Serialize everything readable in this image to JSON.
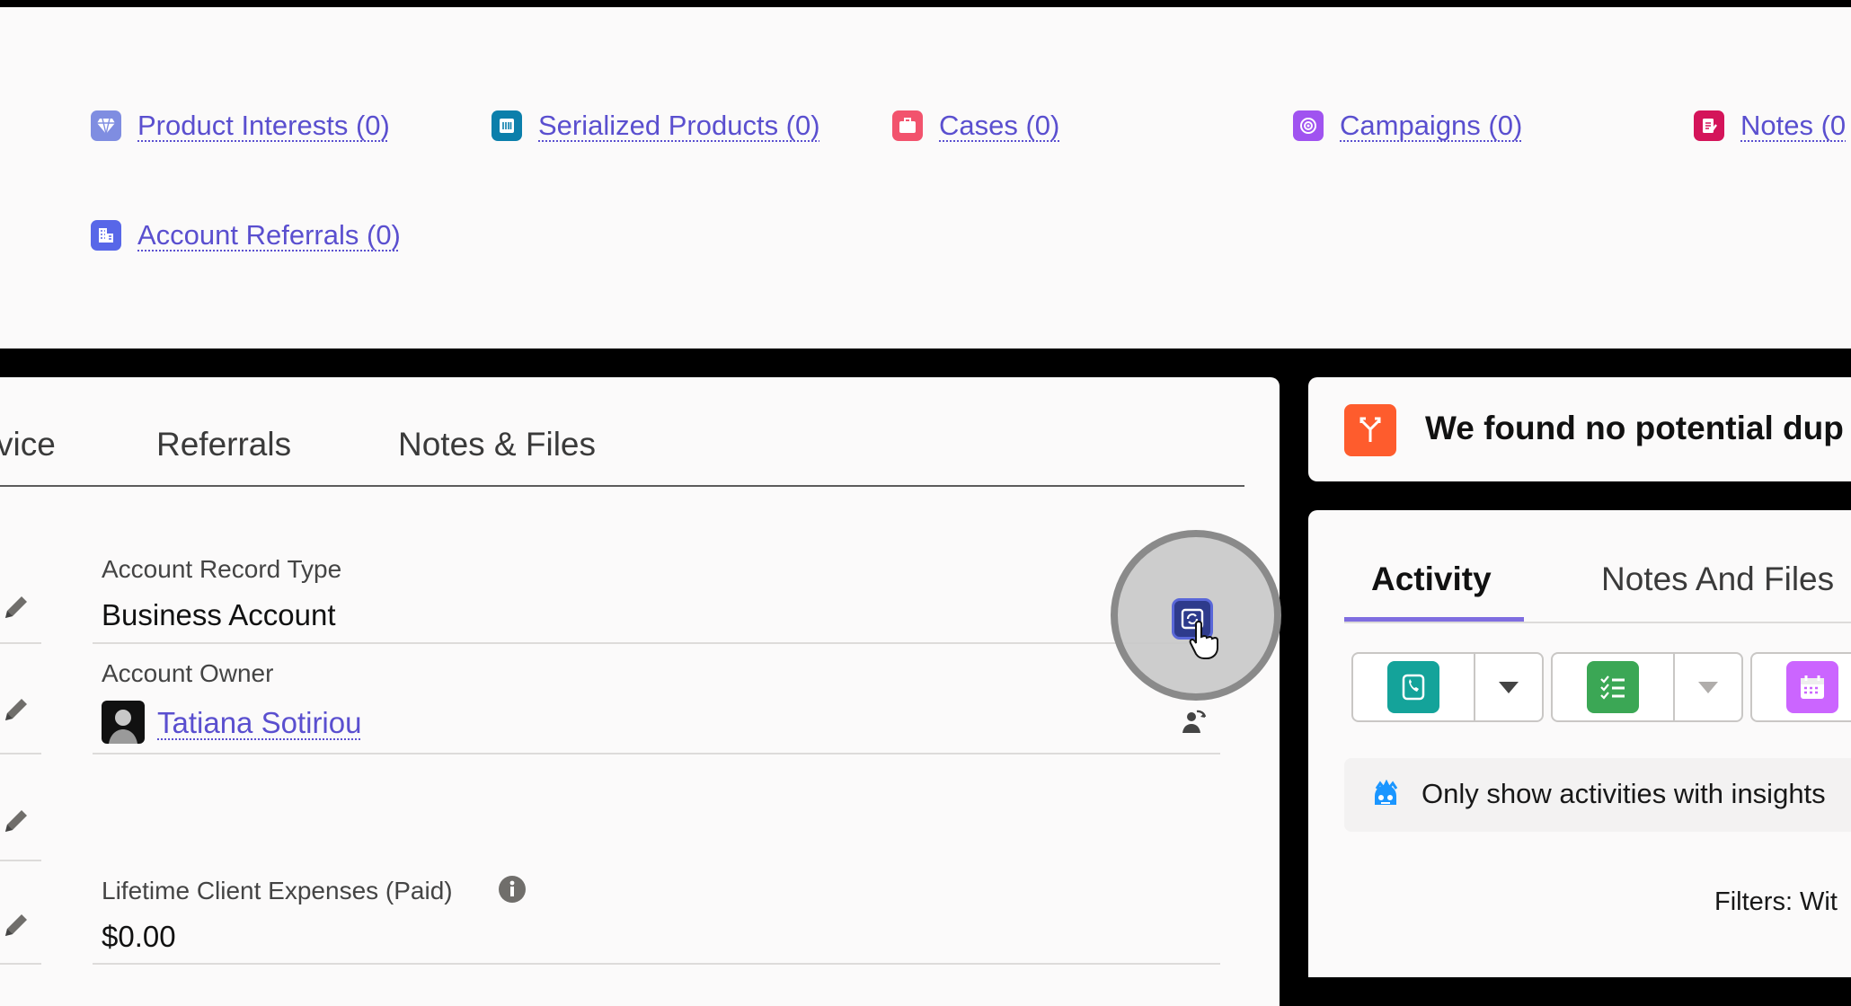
{
  "related_lists": {
    "items": [
      {
        "label": "Product Interests (0)",
        "icon": "diamond-icon",
        "color": "#7f8de1"
      },
      {
        "label": "Serialized Products (0)",
        "icon": "barcode-icon",
        "color": "#0b7fab"
      },
      {
        "label": "Cases (0)",
        "icon": "briefcase-icon",
        "color": "#f2536d"
      },
      {
        "label": "Campaigns (0)",
        "icon": "target-icon",
        "color": "#a053f0"
      },
      {
        "label": "Notes (0",
        "icon": "note-icon",
        "color": "#d4145a"
      },
      {
        "label": "Account Referrals (0)",
        "icon": "building-icon",
        "color": "#5867e8"
      }
    ]
  },
  "detail_tabs": [
    "vice",
    "Referrals",
    "Notes & Files"
  ],
  "fields": {
    "record_type": {
      "label": "Account Record Type",
      "value": "Business Account"
    },
    "owner": {
      "label": "Account Owner",
      "value": "Tatiana Sotiriou"
    },
    "expenses": {
      "label": "Lifetime Client Expenses (Paid)",
      "value": "$0.00"
    }
  },
  "duplicates": {
    "message": "We found no potential dup",
    "icon": "merge-icon",
    "color": "#fe5c2d"
  },
  "activity": {
    "tabs": [
      "Activity",
      "Notes And Files"
    ],
    "accent": "#7f6de0",
    "insights_label": "Only show activities with insights",
    "filters_label": "Filters: Wit",
    "buttons": [
      {
        "icon": "phone-icon",
        "color": "#14a39a"
      },
      {
        "icon": "task-list-icon",
        "color": "#3ba755"
      },
      {
        "icon": "calendar-icon",
        "color": "#cb65ff"
      }
    ]
  }
}
